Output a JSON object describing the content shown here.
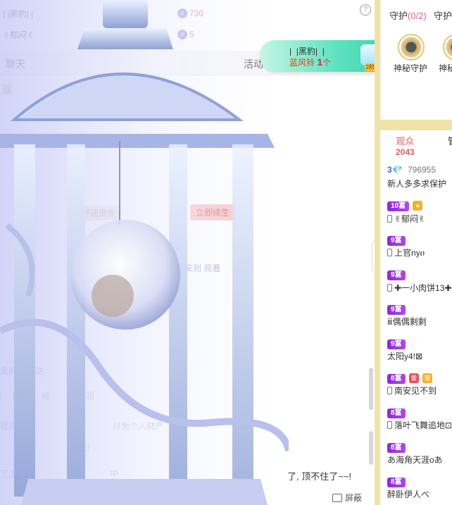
{
  "chat": {
    "rank_rows": [
      {
        "name": "| |黑豹| |",
        "value": "730"
      },
      {
        "name": "✌郁闷✌",
        "value": "5"
      }
    ],
    "tab_chat": "聊天",
    "tab_activity": "活动",
    "faint_tags": [
      "理",
      "开通贵族",
      "立即续生",
      "来到 观看"
    ],
    "faint_lines": [
      "黑豹",
      "送",
      "|",
      "|的",
      "绘",
      "至超",
      "提示",
      "以免个人财产",
      "玩!",
      "了,顶",
      "中"
    ],
    "bottom_line": "了, 顶不住了~~!",
    "danmu_label": "屏蔽",
    "help_glyph": "?"
  },
  "gift_banner": {
    "sender": "|  |黑豹|  |",
    "gift_name": "蓝风铃",
    "count": "1",
    "unit": "个",
    "level_tag": "2阶"
  },
  "guard": {
    "title": "守护",
    "count": "(0/2)",
    "title2": "守护",
    "slots": [
      "神秘守护",
      "神秘"
    ]
  },
  "audience": {
    "tab_label": "观众",
    "count": "2043",
    "manager_tab": "管",
    "viewers": [
      {
        "badge": "3💎",
        "extra": "796955",
        "name": "新人多多求保护",
        "phone": false
      },
      {
        "badge": "10富",
        "name": "✌郁闷✌",
        "phone": true,
        "mini": [
          "#f3b12b"
        ]
      },
      {
        "badge": "9富",
        "name": "上官nyዐ",
        "phone": true
      },
      {
        "badge": "9富",
        "name": "✚一小肉饼13✚",
        "phone": true
      },
      {
        "badge": "9富",
        "name": "ⅲ偶偶剩剩",
        "phone": false
      },
      {
        "badge": "9富",
        "name": "太阳y4!⊠",
        "phone": false
      },
      {
        "badge": "8富",
        "name": "南安见不到",
        "phone": true,
        "mini": [
          "#e8505a",
          "#f3b12b"
        ]
      },
      {
        "badge": "8富",
        "name": "落叶飞舞追地⊡",
        "phone": true
      },
      {
        "badge": "8富",
        "name": "あ海角天涯oあ",
        "phone": false
      },
      {
        "badge": "8富",
        "name": "醉卧伊人べ",
        "phone": false
      }
    ]
  },
  "colors": {
    "accent_gold": "#f1e3a8",
    "rich_badge": "#9b35dc",
    "audience_red": "#e35c5c",
    "banner_green": "#5ee2c0"
  }
}
